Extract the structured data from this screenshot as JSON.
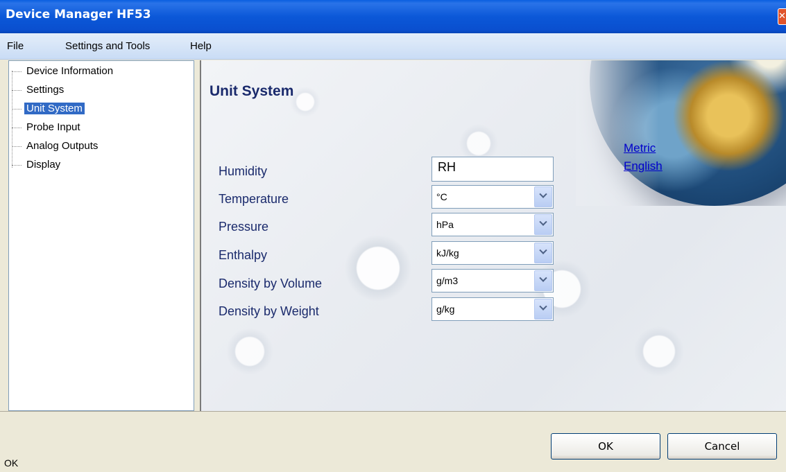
{
  "window": {
    "title": "Device Manager HF53",
    "close_glyph": "✕"
  },
  "menu": {
    "items": [
      "File",
      "Settings and Tools",
      "Help"
    ]
  },
  "tree": {
    "items": [
      {
        "label": "Device Information"
      },
      {
        "label": "Settings"
      },
      {
        "label": "Unit System",
        "selected": true
      },
      {
        "label": "Probe Input"
      },
      {
        "label": "Analog Outputs"
      },
      {
        "label": "Display"
      }
    ]
  },
  "content": {
    "title": "Unit System",
    "presets": {
      "metric": "Metric",
      "english": "English"
    },
    "fields": {
      "humidity": {
        "label": "Humidity",
        "value": "RH"
      },
      "temperature": {
        "label": "Temperature",
        "value": "°C"
      },
      "pressure": {
        "label": "Pressure",
        "value": "hPa"
      },
      "enthalpy": {
        "label": "Enthalpy",
        "value": "kJ/kg"
      },
      "density_volume": {
        "label": "Density by Volume",
        "value": "g/m3"
      },
      "density_weight": {
        "label": "Density by Weight",
        "value": "g/kg"
      }
    }
  },
  "buttons": {
    "ok": "OK",
    "cancel": "Cancel"
  },
  "status": {
    "text": "OK"
  },
  "icons": {
    "close": "close-icon",
    "dropdown": "chevron-down-icon"
  }
}
